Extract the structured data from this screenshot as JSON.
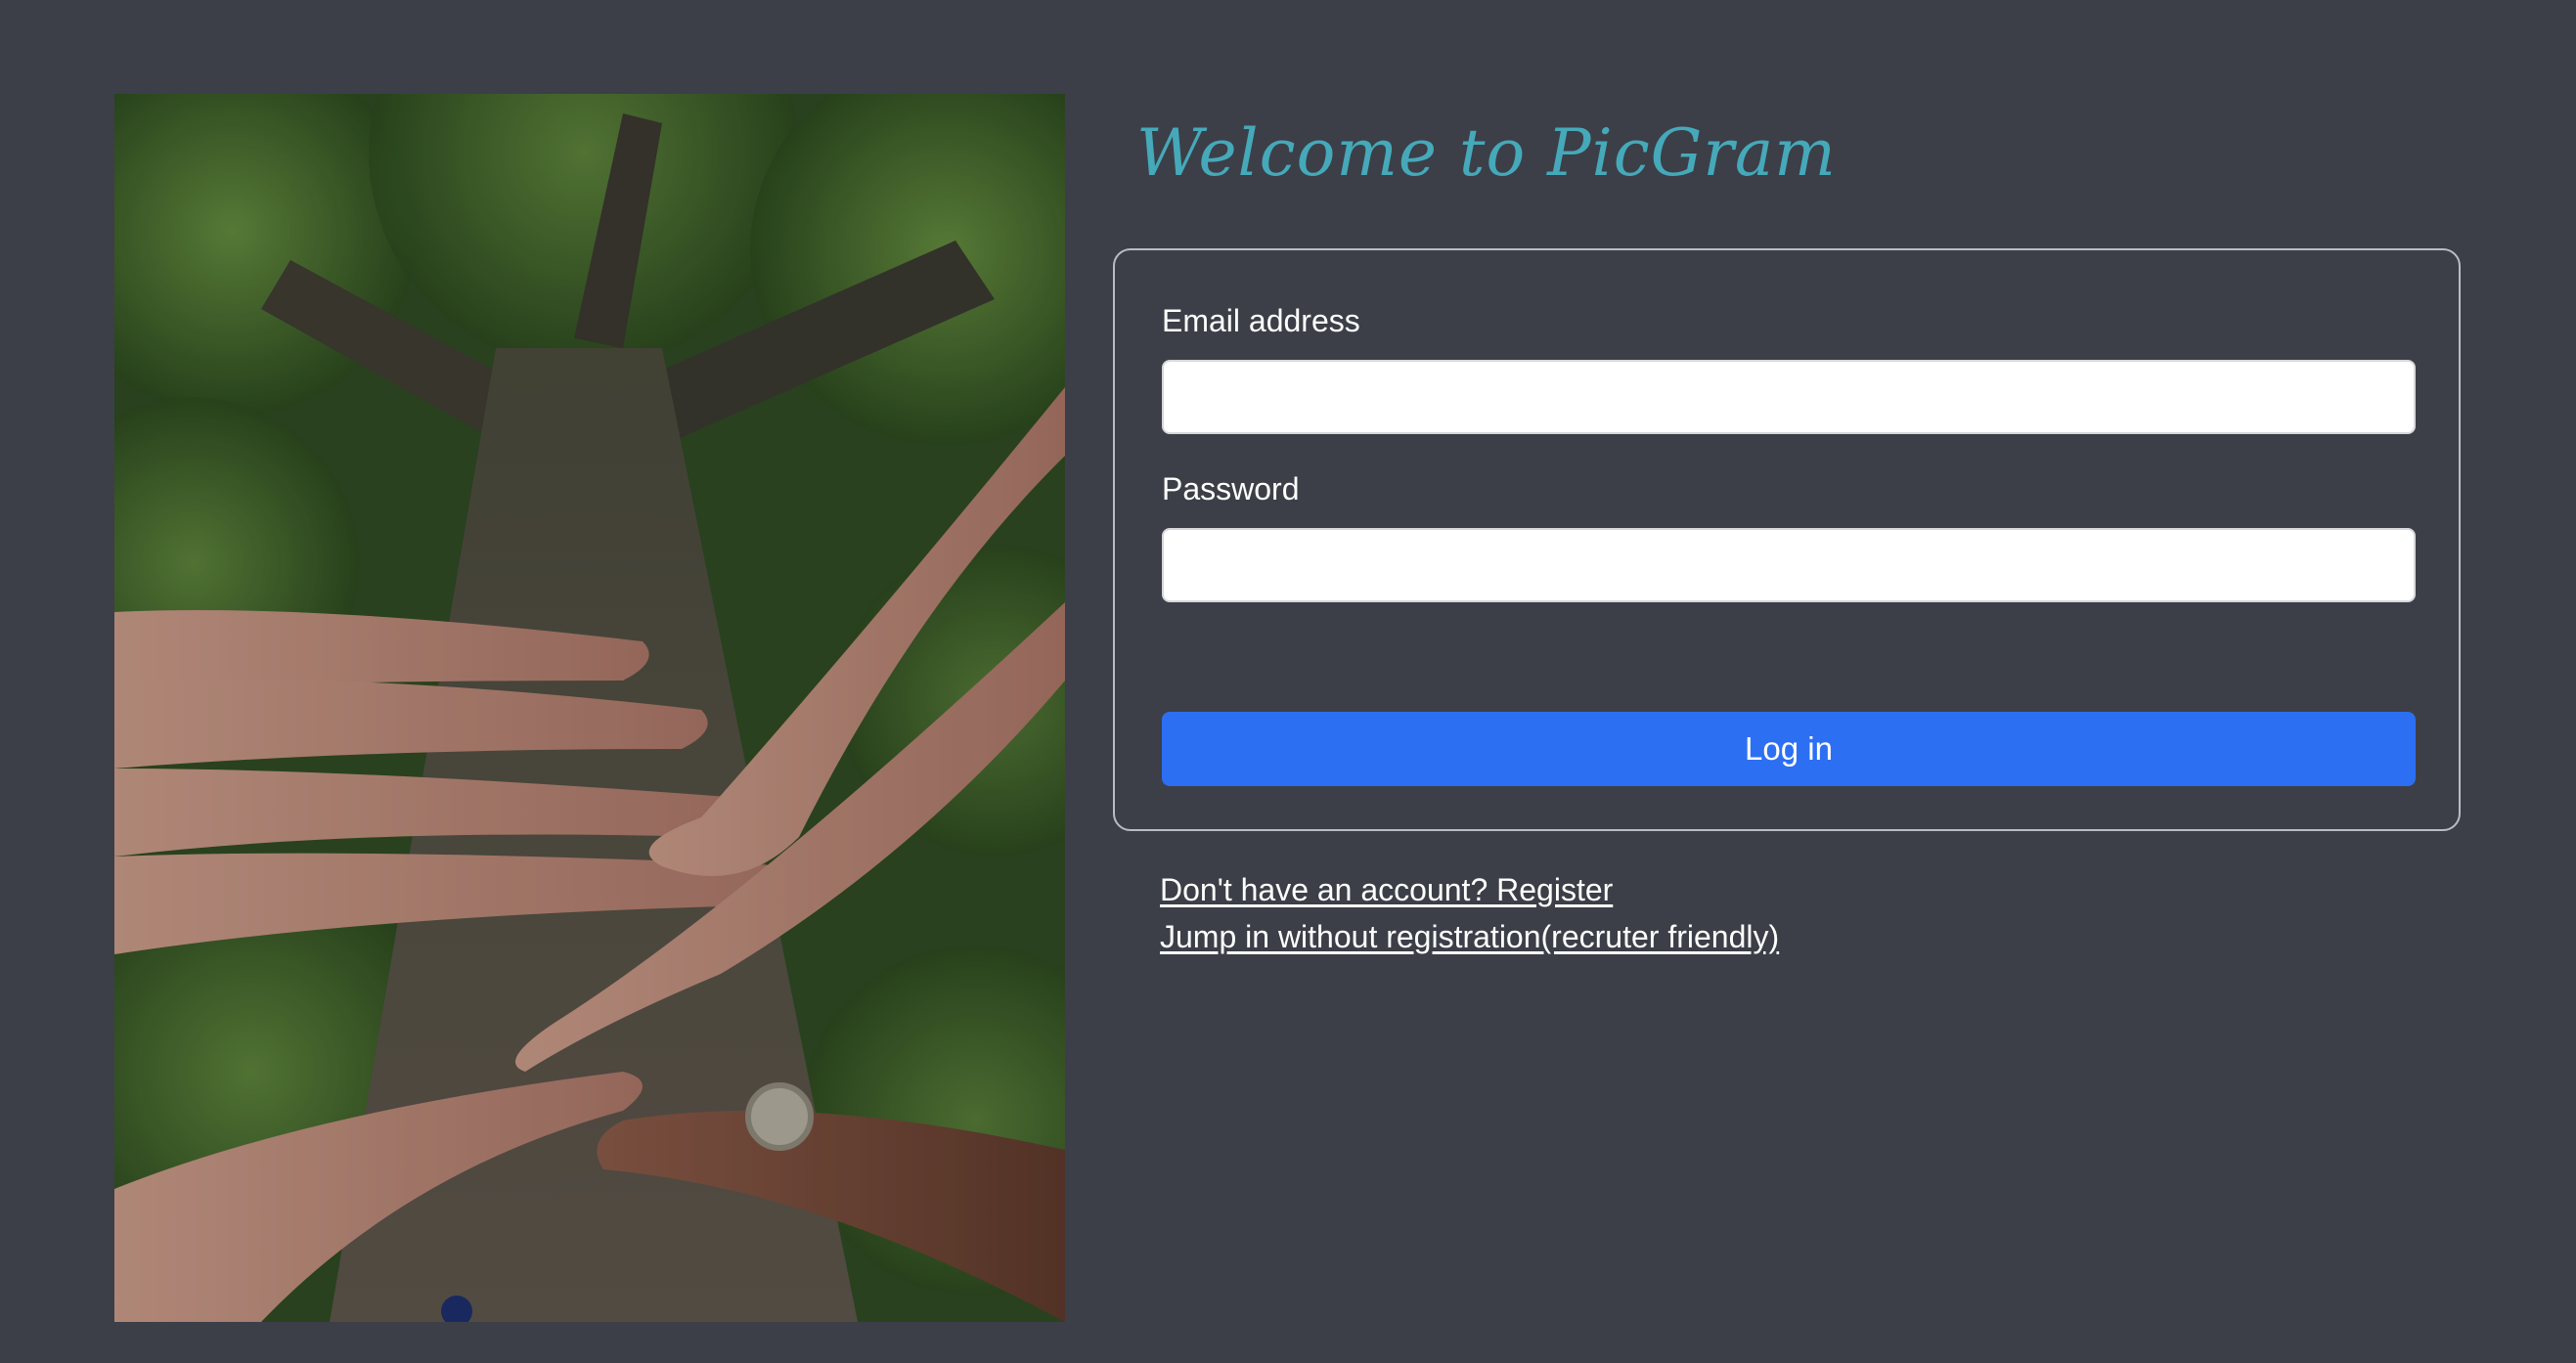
{
  "header": {
    "title": "Welcome to PicGram"
  },
  "hero_image": {
    "description_icon": "image-photo"
  },
  "login_form": {
    "email_label": "Email address",
    "email_value": "",
    "password_label": "Password",
    "password_value": "",
    "submit_label": "Log in"
  },
  "links": {
    "register": "Don't have an account? Register",
    "guest": "Jump in without registration(recruter friendly)"
  },
  "colors": {
    "background": "#3c3f47",
    "title": "#45a9ba",
    "primary_button": "#2d6ff3",
    "card_border": "#b9bcc2"
  }
}
